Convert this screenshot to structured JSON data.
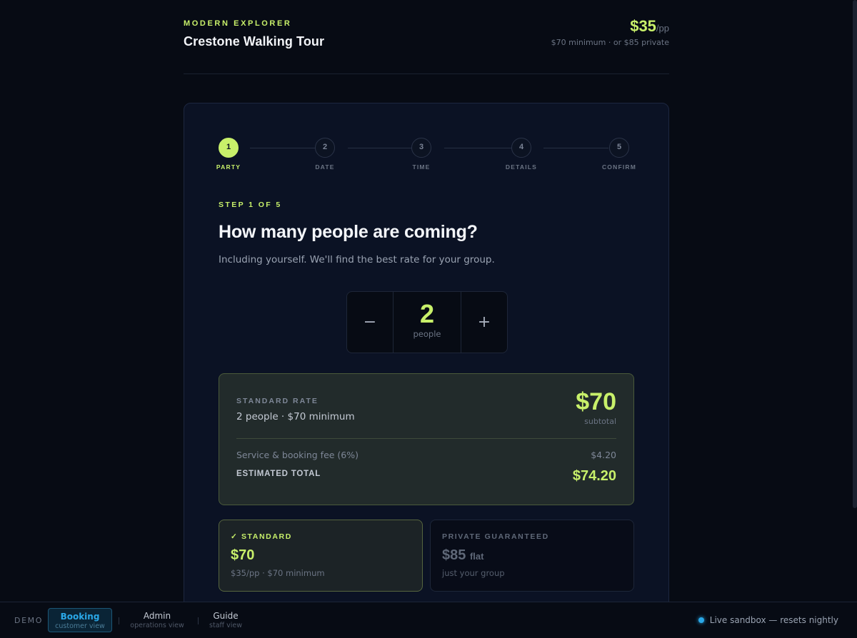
{
  "header": {
    "brand": "MODERN EXPLORER",
    "title": "Crestone Walking Tour",
    "price": "$35",
    "price_unit": "/pp",
    "price_note": "$70 minimum · or $85 private"
  },
  "stepper": {
    "steps": [
      {
        "num": "1",
        "label": "PARTY"
      },
      {
        "num": "2",
        "label": "DATE"
      },
      {
        "num": "3",
        "label": "TIME"
      },
      {
        "num": "4",
        "label": "DETAILS"
      },
      {
        "num": "5",
        "label": "CONFIRM"
      }
    ],
    "active_index": 0
  },
  "step_count": "STEP 1 OF 5",
  "question": "How many people are coming?",
  "question_sub": "Including yourself. We'll find the best rate for your group.",
  "counter": {
    "minus": "−",
    "plus": "+",
    "value": "2",
    "unit": "people"
  },
  "rate": {
    "label": "STANDARD RATE",
    "detail": "2 people · $70 minimum",
    "amount": "$70",
    "amount_sub": "subtotal",
    "fee_label": "Service & booking fee (6%)",
    "fee_amount": "$4.20",
    "total_label": "ESTIMATED TOTAL",
    "total_amount": "$74.20"
  },
  "options": {
    "standard": {
      "check": "✓",
      "title": "STANDARD",
      "price": "$70",
      "sub": "$35/pp · $70 minimum"
    },
    "private": {
      "title": "PRIVATE GUARANTEED",
      "price": "$85",
      "price_suffix": "flat",
      "sub": "just your group"
    }
  },
  "demo_bar": {
    "label": "DEMO",
    "tabs": [
      {
        "name": "Booking",
        "sub": "customer view"
      },
      {
        "name": "Admin",
        "sub": "operations view"
      },
      {
        "name": "Guide",
        "sub": "staff view"
      }
    ],
    "sandbox": "Live sandbox — resets nightly"
  },
  "colors": {
    "accent": "#c8f06a",
    "background": "#070b14",
    "card": "#0b1224",
    "info": "#2aa8e8"
  }
}
